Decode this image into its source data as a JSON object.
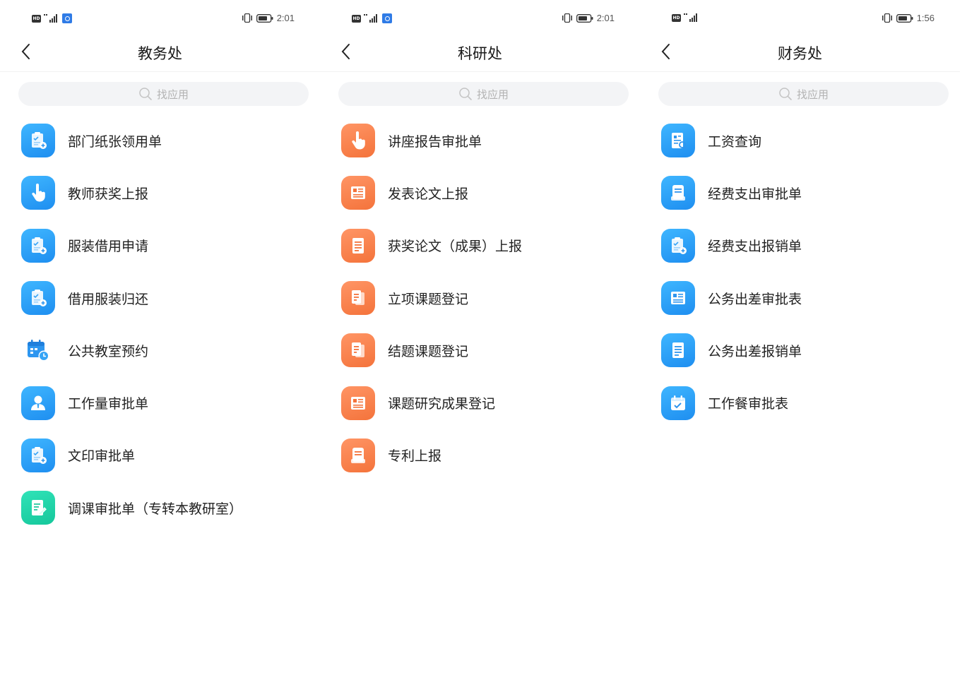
{
  "screens": [
    {
      "status": {
        "hd": "HD",
        "time": "2:01"
      },
      "title": "教务处",
      "search_placeholder": "找应用",
      "items": [
        {
          "label": "部门纸张领用单",
          "icon": "clipboard-document-icon",
          "color": "blue"
        },
        {
          "label": "教师获奖上报",
          "icon": "hand-tap-icon",
          "color": "blue"
        },
        {
          "label": "服装借用申请",
          "icon": "clipboard-document-icon",
          "color": "blue"
        },
        {
          "label": "借用服装归还",
          "icon": "clipboard-document-icon",
          "color": "blue"
        },
        {
          "label": "公共教室预约",
          "icon": "calendar-clock-icon",
          "color": "plain"
        },
        {
          "label": "工作量审批单",
          "icon": "person-badge-icon",
          "color": "blue"
        },
        {
          "label": "文印审批单",
          "icon": "clipboard-document-icon",
          "color": "blue"
        },
        {
          "label": "调课审批单（专转本教研室）",
          "icon": "document-edit-icon",
          "color": "green"
        }
      ]
    },
    {
      "status": {
        "hd": "HD",
        "time": "2:01"
      },
      "title": "科研处",
      "search_placeholder": "找应用",
      "items": [
        {
          "label": "讲座报告审批单",
          "icon": "hand-tap-icon",
          "color": "orange"
        },
        {
          "label": "发表论文上报",
          "icon": "newspaper-icon",
          "color": "orange"
        },
        {
          "label": "获奖论文（成果）上报",
          "icon": "document-lines-icon",
          "color": "orange"
        },
        {
          "label": "立项课题登记",
          "icon": "documents-icon",
          "color": "orange"
        },
        {
          "label": "结题课题登记",
          "icon": "documents-icon",
          "color": "orange"
        },
        {
          "label": "课题研究成果登记",
          "icon": "newspaper-icon",
          "color": "orange"
        },
        {
          "label": "专利上报",
          "icon": "stamp-document-icon",
          "color": "orange"
        }
      ]
    },
    {
      "status": {
        "hd": "HD",
        "time": "1:56"
      },
      "title": "财务处",
      "search_placeholder": "找应用",
      "items": [
        {
          "label": "工资查询",
          "icon": "document-search-icon",
          "color": "blue"
        },
        {
          "label": "经费支出审批单",
          "icon": "stamp-document-icon",
          "color": "blue"
        },
        {
          "label": "经费支出报销单",
          "icon": "clipboard-document-icon",
          "color": "blue"
        },
        {
          "label": "公务出差审批表",
          "icon": "newspaper-icon",
          "color": "blue"
        },
        {
          "label": "公务出差报销单",
          "icon": "document-lines-icon",
          "color": "blue"
        },
        {
          "label": "工作餐审批表",
          "icon": "calendar-check-icon",
          "color": "blue"
        }
      ]
    }
  ]
}
